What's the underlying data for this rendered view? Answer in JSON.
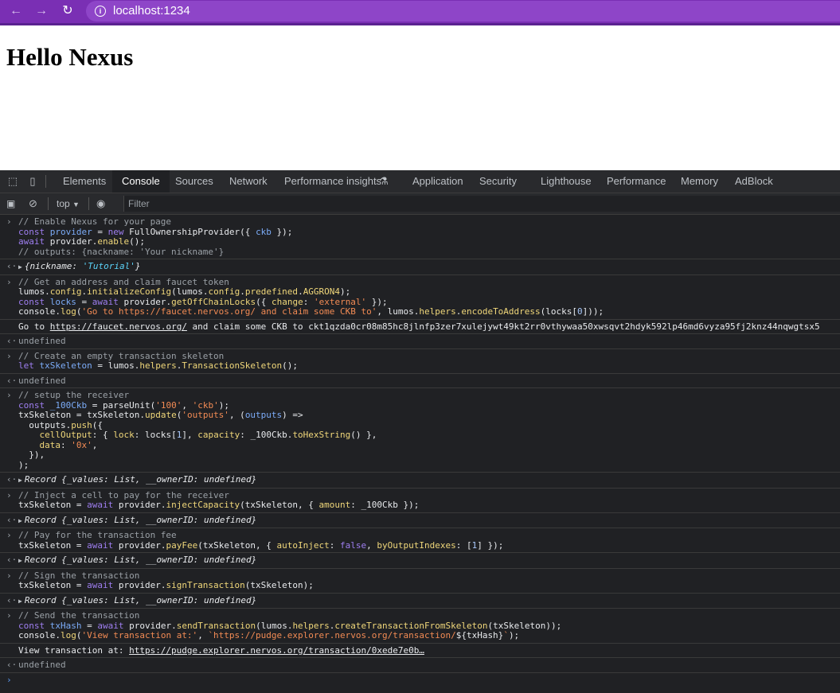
{
  "browser": {
    "url": "localhost:1234"
  },
  "page": {
    "heading": "Hello Nexus"
  },
  "devtools": {
    "tabs": [
      "Elements",
      "Console",
      "Sources",
      "Network",
      "Performance insights",
      "Application",
      "Security",
      "Lighthouse",
      "Performance",
      "Memory",
      "AdBlock"
    ],
    "active_tab": "Console",
    "context": "top",
    "filter_placeholder": "Filter"
  },
  "console": {
    "block1_comment1": "// Enable Nexus for your page",
    "block1_comment2": "// outputs: {nackname: 'Your nickname'}",
    "block1_result_key": "nickname",
    "block1_result_value": "'Tutorial'",
    "block2_comment": "// Get an address and claim faucet token",
    "block2_log_prefix": "Go to ",
    "block2_log_link": "https://faucet.nervos.org/",
    "block2_log_suffix": " and claim some CKB to ckt1qzda0cr08m85hc8jlnfp3zer7xulejywt49kt2rr0vthywaa50xwsqvt2hdyk592lp46md6vyza95fj2knz44nqwgtsx5",
    "undefined": "undefined",
    "block3_comment": "// Create an empty transaction skeleton",
    "block4_comment": "// setup the receiver",
    "record_result": "Record {_values: List, __ownerID: undefined}",
    "block5_comment": "// Inject a cell to pay for the receiver",
    "block6_comment": "// Pay for the transaction fee",
    "block7_comment": "// Sign the transaction",
    "block8_comment": "// Send the transaction",
    "block8_log_prefix": "View transaction at: ",
    "block8_log_link": "https://pudge.explorer.nervos.org/transaction/0xede7e0b…"
  },
  "colors": {
    "browser_bar": "#7a2fb4",
    "devtools_bg": "#202124"
  }
}
